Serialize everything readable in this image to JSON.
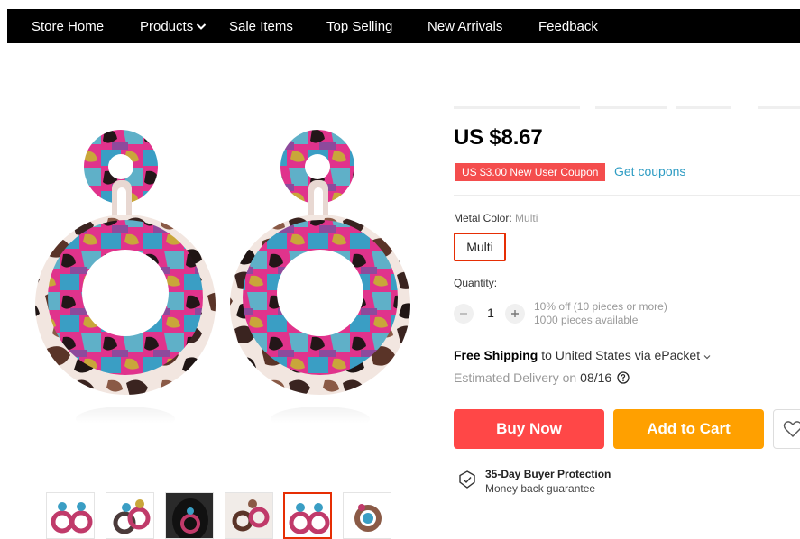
{
  "nav": {
    "items": [
      {
        "label": "Store Home"
      },
      {
        "label": "Products"
      },
      {
        "label": "Sale Items"
      },
      {
        "label": "Top Selling"
      },
      {
        "label": "New Arrivals"
      },
      {
        "label": "Feedback"
      }
    ]
  },
  "product": {
    "price": "US $8.67",
    "coupon": "US $3.00 New User Coupon",
    "get_coupons": "Get coupons",
    "metal_color_label": "Metal Color:",
    "metal_color_value": "Multi",
    "sku_option": "Multi",
    "quantity_label": "Quantity:",
    "quantity_value": "1",
    "quantity_discount": "10% off (10 pieces or more)",
    "quantity_available": "1000 pieces available",
    "shipping_bold": "Free Shipping",
    "shipping_rest": "to United States via ePacket",
    "delivery_label": "Estimated Delivery on",
    "delivery_date": "08/16",
    "buy_now": "Buy Now",
    "add_to_cart": "Add to Cart",
    "protection_title": "35-Day Buyer Protection",
    "protection_sub": "Money back guarantee"
  },
  "thumbnails": {
    "count": 6,
    "active_index": 4
  },
  "colors": {
    "nav_bg": "#000000",
    "buy_now": "#ff4747",
    "add_to_cart": "#ffa000",
    "coupon_bg": "#f44d4d",
    "link": "#2e9cc3",
    "selected_border": "#e62e04"
  }
}
